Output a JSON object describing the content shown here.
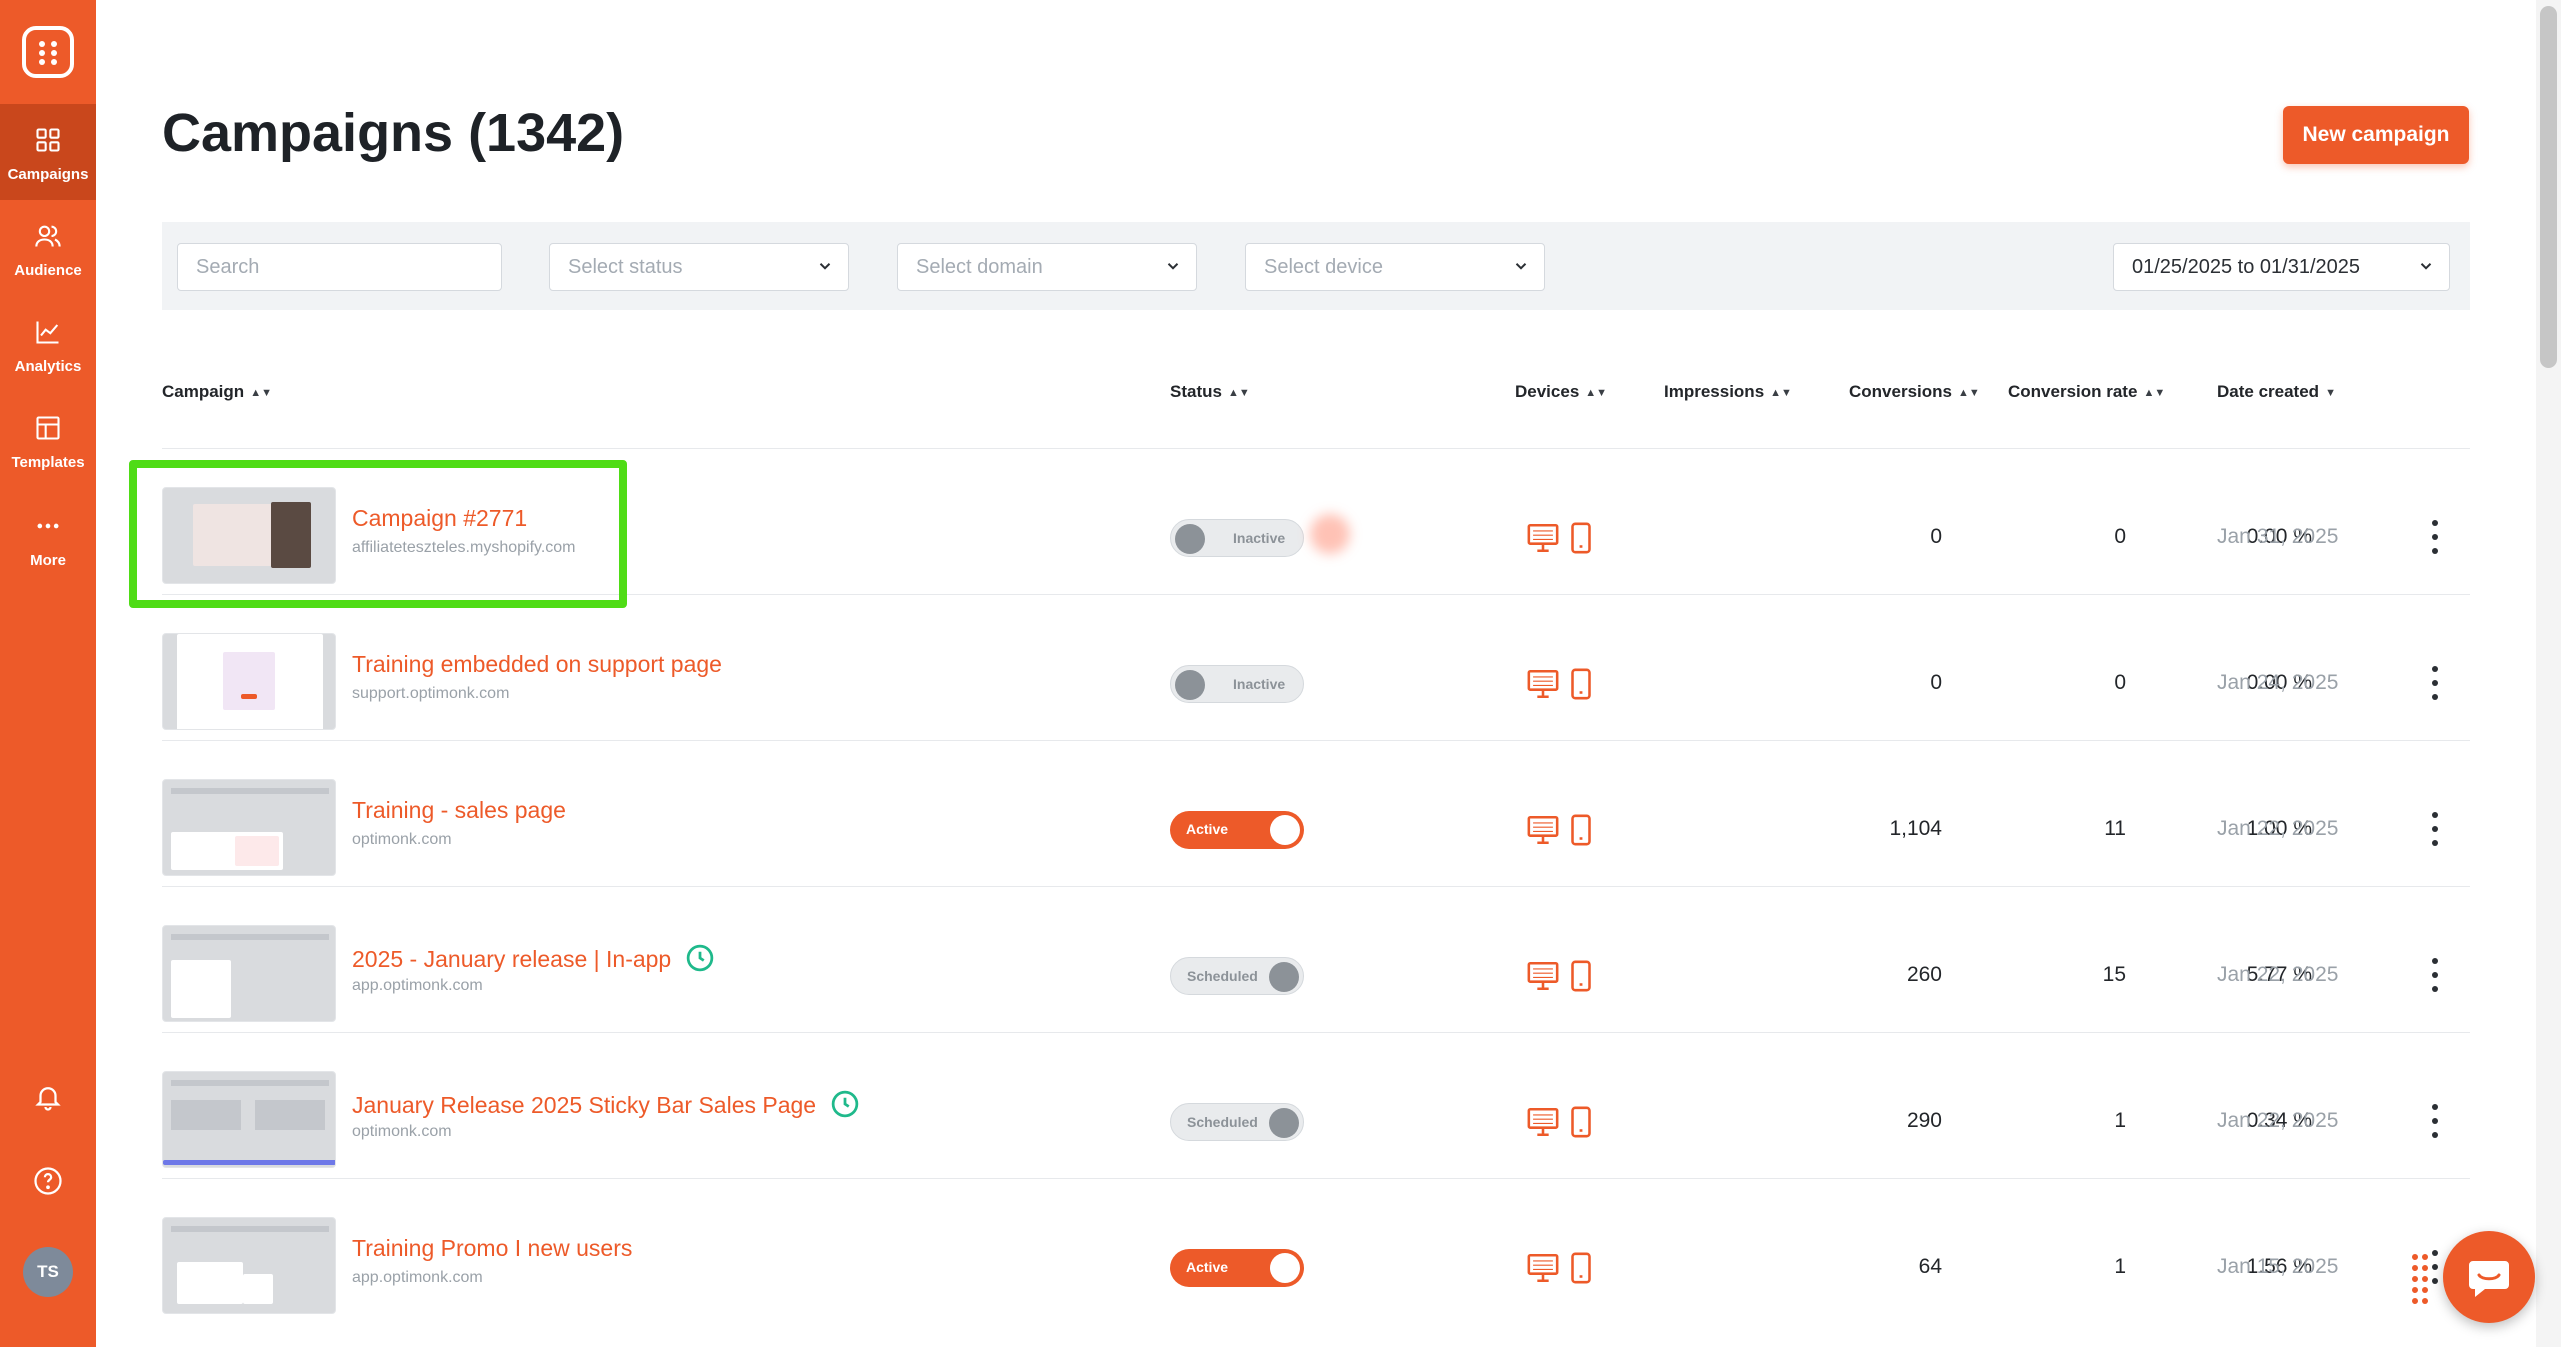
{
  "sidebar": {
    "items": [
      {
        "label": "Campaigns",
        "icon": "grid-icon"
      },
      {
        "label": "Audience",
        "icon": "users-icon"
      },
      {
        "label": "Analytics",
        "icon": "chart-line-icon"
      },
      {
        "label": "Templates",
        "icon": "layout-icon"
      },
      {
        "label": "More",
        "icon": "dots-icon"
      }
    ],
    "avatar_initials": "TS"
  },
  "header": {
    "title": "Campaigns (1342)",
    "new_campaign_label": "New campaign"
  },
  "filters": {
    "search_placeholder": "Search",
    "status_placeholder": "Select status",
    "domain_placeholder": "Select domain",
    "device_placeholder": "Select device",
    "date_range": "01/25/2025 to 01/31/2025"
  },
  "table": {
    "columns": [
      "Campaign",
      "Status",
      "Devices",
      "Impressions",
      "Conversions",
      "Conversion rate",
      "Date created"
    ],
    "rows": [
      {
        "name": "Campaign #2771",
        "domain": "affiliateteszteles.myshopify.com",
        "status": "Inactive",
        "impressions": "0",
        "conversions": "0",
        "rate": "0.00 %",
        "date": "Jan 31, 2025",
        "scheduled_icon": false
      },
      {
        "name": "Training embedded on support page",
        "domain": "support.optimonk.com",
        "status": "Inactive",
        "impressions": "0",
        "conversions": "0",
        "rate": "0.00 %",
        "date": "Jan 24, 2025",
        "scheduled_icon": false
      },
      {
        "name": "Training - sales page",
        "domain": "optimonk.com",
        "status": "Active",
        "impressions": "1,104",
        "conversions": "11",
        "rate": "1.00 %",
        "date": "Jan 22, 2025",
        "scheduled_icon": false
      },
      {
        "name": "2025 - January release | In-app",
        "domain": "app.optimonk.com",
        "status": "Scheduled",
        "impressions": "260",
        "conversions": "15",
        "rate": "5.77 %",
        "date": "Jan 22, 2025",
        "scheduled_icon": true
      },
      {
        "name": "January Release 2025 Sticky Bar Sales Page",
        "domain": "optimonk.com",
        "status": "Scheduled",
        "impressions": "290",
        "conversions": "1",
        "rate": "0.34 %",
        "date": "Jan 22, 2025",
        "scheduled_icon": true
      },
      {
        "name": "Training Promo I new users",
        "domain": "app.optimonk.com",
        "status": "Active",
        "impressions": "64",
        "conversions": "1",
        "rate": "1.56 %",
        "date": "Jan 15, 2025",
        "scheduled_icon": false
      }
    ]
  },
  "colors": {
    "brand": "#ed5a29",
    "highlight": "#4fdc16",
    "scheduled_clock": "#1fb98b"
  }
}
